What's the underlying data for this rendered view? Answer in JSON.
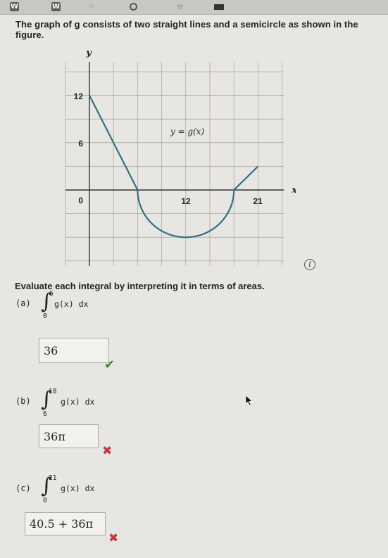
{
  "toolbar": {
    "icons": [
      "w-icon",
      "w-icon",
      "dots-icon",
      "circle-icon",
      "star-icon",
      "block-icon"
    ],
    "w_label": "W"
  },
  "problem": {
    "text": "The graph of g consists of two straight lines and a semicircle as shown in the figure."
  },
  "graph": {
    "y_axis_label": "y",
    "x_axis_label": "x",
    "y_ticks": [
      "12",
      "6",
      "0"
    ],
    "x_ticks": [
      "12",
      "21"
    ],
    "function_label": "y = g(x)",
    "x_range": [
      0,
      24
    ],
    "y_range": [
      -6,
      15
    ],
    "pieces": [
      {
        "shape": "line",
        "from": [
          0,
          12
        ],
        "to": [
          6,
          0
        ]
      },
      {
        "shape": "semicircle",
        "center": [
          12,
          0
        ],
        "radius": 6,
        "side": "below"
      },
      {
        "shape": "line",
        "from": [
          18,
          0
        ],
        "to": [
          21,
          3
        ]
      }
    ],
    "info_icon": "i"
  },
  "instruction": "Evaluate each integral by interpreting it in terms of areas.",
  "parts": [
    {
      "label": "(a)",
      "lower": "0",
      "upper": "6",
      "integrand": "g(x) dx",
      "answer": "36",
      "status": "correct"
    },
    {
      "label": "(b)",
      "lower": "6",
      "upper": "18",
      "integrand": "g(x) dx",
      "answer": "36π",
      "status": "incorrect"
    },
    {
      "label": "(c)",
      "lower": "0",
      "upper": "21",
      "integrand": "g(x) dx",
      "answer": "40.5 + 36π",
      "status": "incorrect"
    }
  ],
  "colors": {
    "curve": "#2f6f86",
    "grid": "#9a9893",
    "correct": "#3a8a3a",
    "incorrect": "#c43a3a"
  }
}
